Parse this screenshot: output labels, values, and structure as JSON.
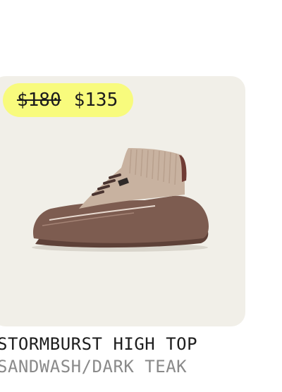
{
  "product": {
    "name": "STORMBURST HIGH TOP",
    "colorway": "SANDWASH/DARK TEAK",
    "price_original": "$180",
    "price_sale": "$135",
    "image_icon": "sneaker-image"
  },
  "colors": {
    "card_background": "#f1efe8",
    "badge_background": "#f8fb7d",
    "upper_knit": "#c7b19f",
    "sole": "#7a5a4e",
    "outsole": "#5e4138"
  }
}
